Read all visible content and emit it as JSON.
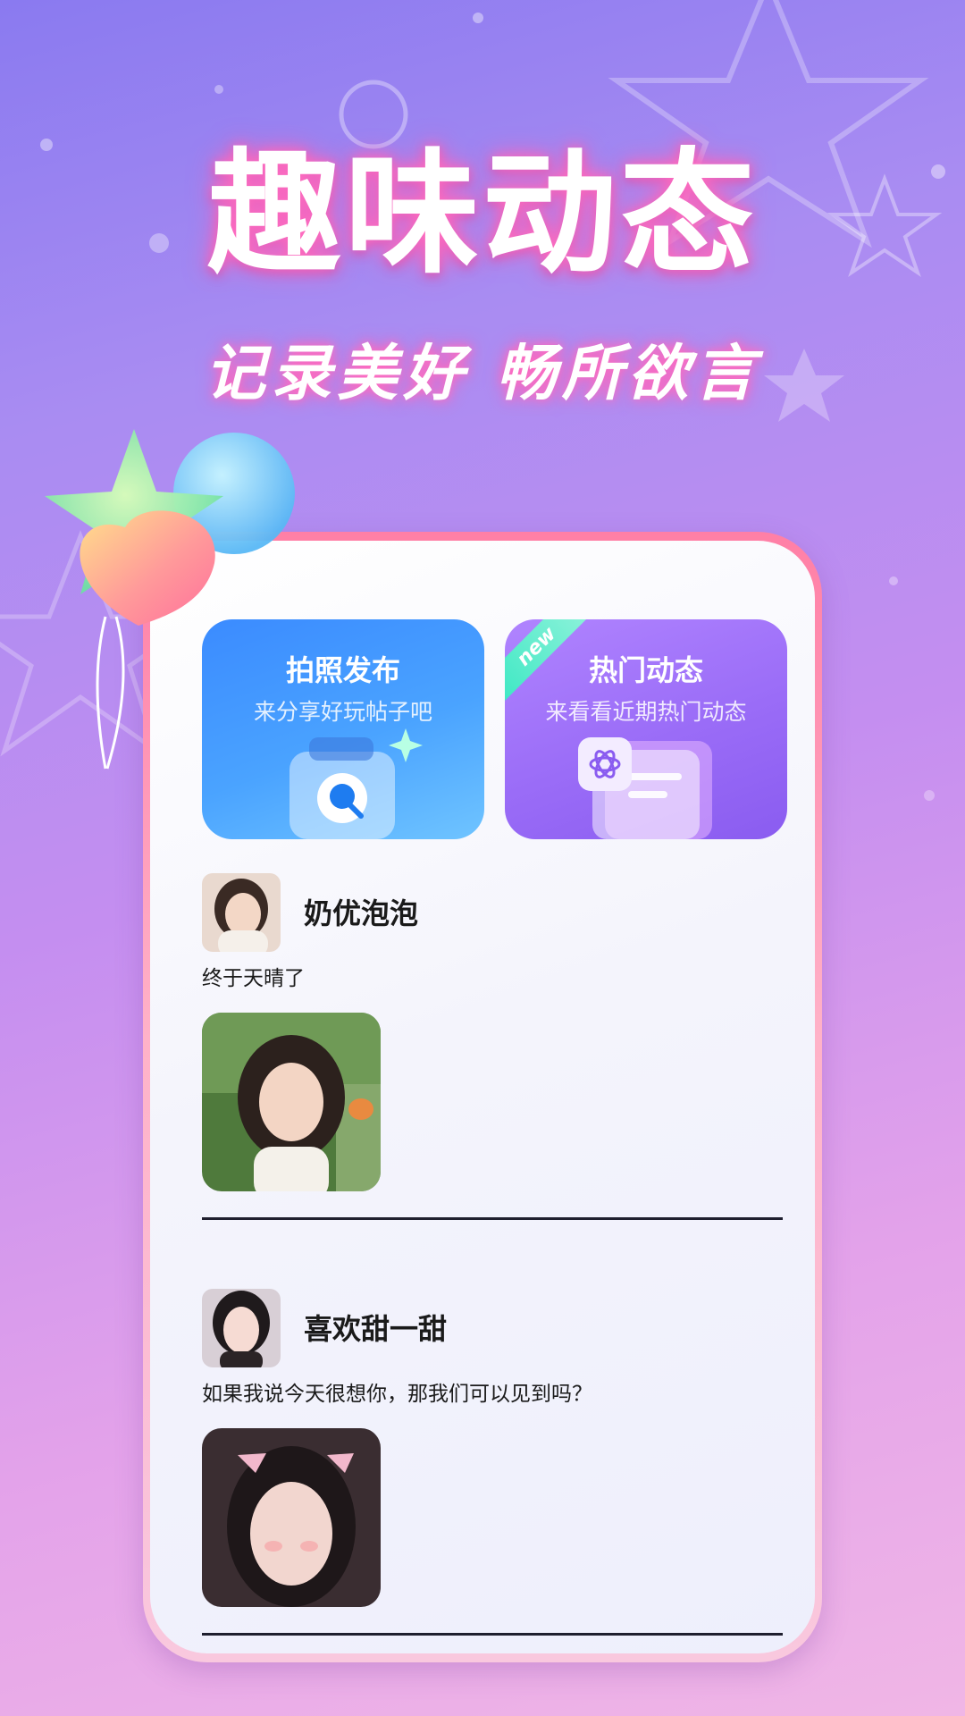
{
  "hero": {
    "title": "趣味动态",
    "subtitle": "记录美好 畅所欲言"
  },
  "cards": [
    {
      "title": "拍照发布",
      "subtitle": "来分享好玩帖子吧",
      "icon": "camera-search-icon"
    },
    {
      "title": "热门动态",
      "subtitle": "来看看近期热门动态",
      "badge": "new",
      "icon": "document-atom-icon"
    }
  ],
  "posts": [
    {
      "username": "奶优泡泡",
      "caption": "终于天晴了"
    },
    {
      "username": "喜欢甜一甜",
      "caption": "如果我说今天很想你，那我们可以见到吗？"
    }
  ],
  "colors": {
    "accent_blue": "#3b8bff",
    "accent_purple": "#9a6cf7",
    "frame_pink": "#ff7fa6",
    "glow_pink": "#ff5cb8"
  }
}
